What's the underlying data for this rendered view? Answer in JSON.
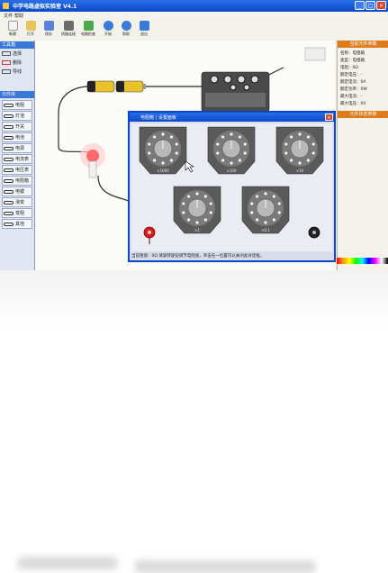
{
  "window": {
    "title": "中学电路虚拟实验室  V4.1",
    "controls": [
      "_",
      "□",
      "×"
    ]
  },
  "menu": [
    "文件",
    "帮助"
  ],
  "toolbar": [
    {
      "label": "新建",
      "color": "#f3f3f3",
      "icon": "new-file-icon"
    },
    {
      "label": "打开",
      "color": "#e8c25a",
      "icon": "open-folder-icon"
    },
    {
      "label": "保存",
      "color": "#5a82d8",
      "icon": "save-icon"
    },
    {
      "label": "线路连接",
      "color": "#6b6b6b",
      "icon": "wire-icon"
    },
    {
      "label": "电路检查",
      "color": "#4aa84a",
      "icon": "check-icon"
    },
    {
      "label": "开始",
      "color": "#3a7ad8",
      "icon": "start-icon"
    },
    {
      "label": "帮助",
      "color": "#3a7ad8",
      "icon": "help-icon"
    },
    {
      "label": "退出",
      "color": "#3a7ad8",
      "icon": "exit-icon"
    }
  ],
  "left_panel": {
    "tools_header": "工具箱",
    "tools": [
      "选择",
      "删除",
      "导线"
    ],
    "components_header": "元件库",
    "components": [
      "电阻",
      "灯泡",
      "开关",
      "电池",
      "电源",
      "电流表",
      "电压表",
      "电阻箱",
      "电键",
      "滑变",
      "变阻",
      "其他"
    ]
  },
  "right_panel": {
    "header1": "当前元件参数",
    "rows": [
      "名称：电阻箱",
      "类型：电阻箱",
      "电阻：0Ω",
      "额定电压：-",
      "额定电流：0A",
      "额定功率：0W",
      "最大电流：-",
      "最大电压：0V"
    ],
    "header2": "元件状态参数"
  },
  "dialog": {
    "title": "电阻箱 | 设置面板",
    "close": "×",
    "status": "当前阻值：0Ω     请旋转旋钮调节电阻值，单击任一位置可以关闭此对话框。",
    "knob_labels": [
      "×1000",
      "×100",
      "×10",
      "×1",
      "×0.1"
    ]
  },
  "colors": {
    "titlebar": "#0a48c8",
    "panel_header": "#e07b1a",
    "section": "#3a78d8",
    "wire": "#2b2b2b",
    "terminal_red": "#d81b1b"
  }
}
